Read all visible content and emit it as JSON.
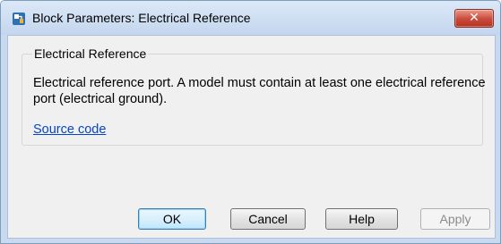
{
  "window": {
    "title": "Block Parameters: Electrical Reference",
    "icon": "simulink-block-icon",
    "close_icon": "close-icon"
  },
  "group": {
    "title": "Electrical Reference",
    "description": "Electrical reference port. A model must contain at least one electrical reference port (electrical ground).",
    "link_label": "Source code"
  },
  "buttons": {
    "ok": "OK",
    "cancel": "Cancel",
    "help": "Help",
    "apply": "Apply"
  },
  "colors": {
    "link": "#0645c8",
    "close_button": "#c9493a",
    "titlebar": "#c4d6ee"
  }
}
